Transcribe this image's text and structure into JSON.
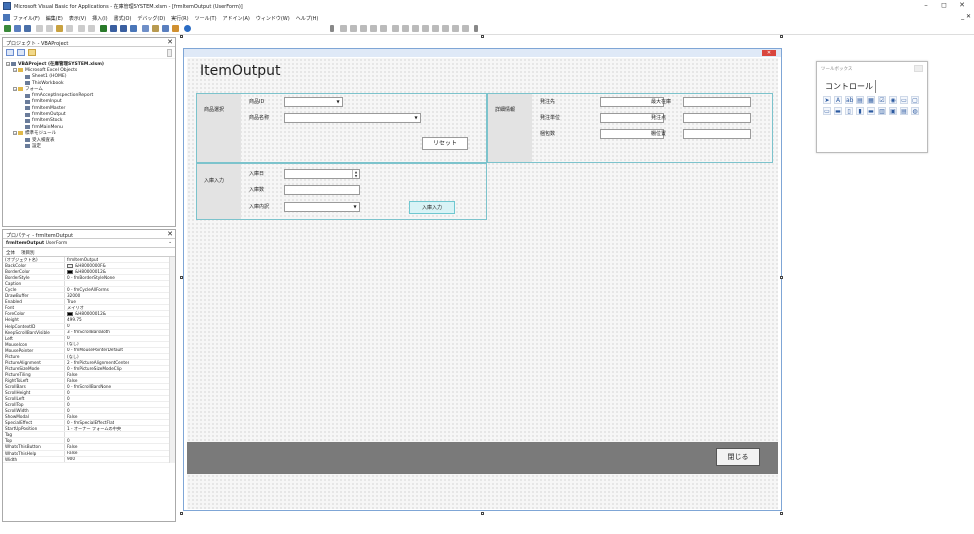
{
  "window": {
    "title": "Microsoft Visual Basic for Applications - 在庫管理SYSTEM.xlsm - [frmItemOutput (UserForm)]",
    "minimize": "–",
    "maximize": "◻",
    "close": "✕"
  },
  "menu": {
    "items": [
      "ファイル(F)",
      "編集(E)",
      "表示(V)",
      "挿入(I)",
      "書式(O)",
      "デバッグ(D)",
      "実行(R)",
      "ツール(T)",
      "アドイン(A)",
      "ウィンドウ(W)",
      "ヘルプ(H)"
    ],
    "doc_controls": "_ ✕"
  },
  "project_panel": {
    "title": "プロジェクト - VBAProject",
    "close": "✕",
    "tree": [
      {
        "label": "VBAProject (在庫管理SYSTEM.xlsm)",
        "level": 0,
        "expander": "−",
        "bold": true
      },
      {
        "label": "Microsoft Excel Objects",
        "level": 1,
        "expander": "−"
      },
      {
        "label": "Sheet1 (HOME)",
        "level": 2
      },
      {
        "label": "ThisWorkbook",
        "level": 2
      },
      {
        "label": "フォーム",
        "level": 1,
        "expander": "−"
      },
      {
        "label": "frmAcceptInspectionReport",
        "level": 2
      },
      {
        "label": "frmItemInput",
        "level": 2
      },
      {
        "label": "frmItemMaster",
        "level": 2
      },
      {
        "label": "frmItemOutput",
        "level": 2
      },
      {
        "label": "frmItemStock",
        "level": 2
      },
      {
        "label": "frmMainMenu",
        "level": 2
      },
      {
        "label": "標準モジュール",
        "level": 1,
        "expander": "−"
      },
      {
        "label": "受入検査表",
        "level": 2
      },
      {
        "label": "設定",
        "level": 2
      }
    ]
  },
  "properties_panel": {
    "title": "プロパティ - frmItemOutput",
    "close": "✕",
    "object": "frmItemOutput",
    "object_type": "UserForm",
    "tabs": [
      "全体",
      "項目別"
    ],
    "rows": [
      {
        "k": "(オブジェクト名)",
        "v": "frmItemOutput"
      },
      {
        "k": "BackColor",
        "v": "&H8000000F&",
        "swatch": "#f0f0f0"
      },
      {
        "k": "BorderColor",
        "v": "&H80000012&",
        "swatch": "#000000"
      },
      {
        "k": "BorderStyle",
        "v": "0 - fmBorderStyleNone"
      },
      {
        "k": "Caption",
        "v": ""
      },
      {
        "k": "Cycle",
        "v": "0 - fmCycleAllForms"
      },
      {
        "k": "DrawBuffer",
        "v": "32000"
      },
      {
        "k": "Enabled",
        "v": "True"
      },
      {
        "k": "Font",
        "v": "メイリオ"
      },
      {
        "k": "ForeColor",
        "v": "&H80000012&",
        "swatch": "#000000"
      },
      {
        "k": "Height",
        "v": "499.75"
      },
      {
        "k": "HelpContextID",
        "v": "0"
      },
      {
        "k": "KeepScrollBarsVisible",
        "v": "3 - fmScrollBarsBoth"
      },
      {
        "k": "Left",
        "v": "0"
      },
      {
        "k": "MouseIcon",
        "v": "(なし)"
      },
      {
        "k": "MousePointer",
        "v": "0 - fmMousePointerDefault"
      },
      {
        "k": "Picture",
        "v": "(なし)"
      },
      {
        "k": "PictureAlignment",
        "v": "2 - fmPictureAlignmentCenter"
      },
      {
        "k": "PictureSizeMode",
        "v": "0 - fmPictureSizeModeClip"
      },
      {
        "k": "PictureTiling",
        "v": "False"
      },
      {
        "k": "RightToLeft",
        "v": "False"
      },
      {
        "k": "ScrollBars",
        "v": "0 - fmScrollBarsNone"
      },
      {
        "k": "ScrollHeight",
        "v": "0"
      },
      {
        "k": "ScrollLeft",
        "v": "0"
      },
      {
        "k": "ScrollTop",
        "v": "0"
      },
      {
        "k": "ScrollWidth",
        "v": "0"
      },
      {
        "k": "ShowModal",
        "v": "False"
      },
      {
        "k": "SpecialEffect",
        "v": "0 - fmSpecialEffectFlat"
      },
      {
        "k": "StartUpPosition",
        "v": "1 - オーナー フォームの中央"
      },
      {
        "k": "Tag",
        "v": ""
      },
      {
        "k": "Top",
        "v": "0"
      },
      {
        "k": "WhatsThisButton",
        "v": "False"
      },
      {
        "k": "WhatsThisHelp",
        "v": "False"
      },
      {
        "k": "Width",
        "v": "900"
      }
    ]
  },
  "form": {
    "heading": "ItemOutput",
    "close_glyph": "✕",
    "item_select": {
      "label": "商品選択",
      "item_id_label": "商品ID",
      "item_name_label": "商品名称",
      "reset_button": "リセット"
    },
    "details": {
      "label": "詳細情報",
      "left_fields": [
        "発注先",
        "発注単位",
        "梱包数"
      ],
      "right_fields": [
        "最大在庫",
        "発注点",
        "棚位置"
      ]
    },
    "stock_in": {
      "label": "入庫入力",
      "date_label": "入庫日",
      "qty_label": "入庫数",
      "detail_label": "入庫内訳",
      "submit_button": "入庫入力"
    },
    "close_button": "閉じる"
  },
  "toolbox": {
    "title": "ツールボックス",
    "tab": "コントロール",
    "tools": [
      "➤",
      "A",
      "ab",
      "▤",
      "▦",
      "☑",
      "◉",
      "▭",
      "▢",
      "▭",
      "▬",
      "▯",
      "▮",
      "▬",
      "▥",
      "▣",
      "▤",
      "◍"
    ]
  }
}
